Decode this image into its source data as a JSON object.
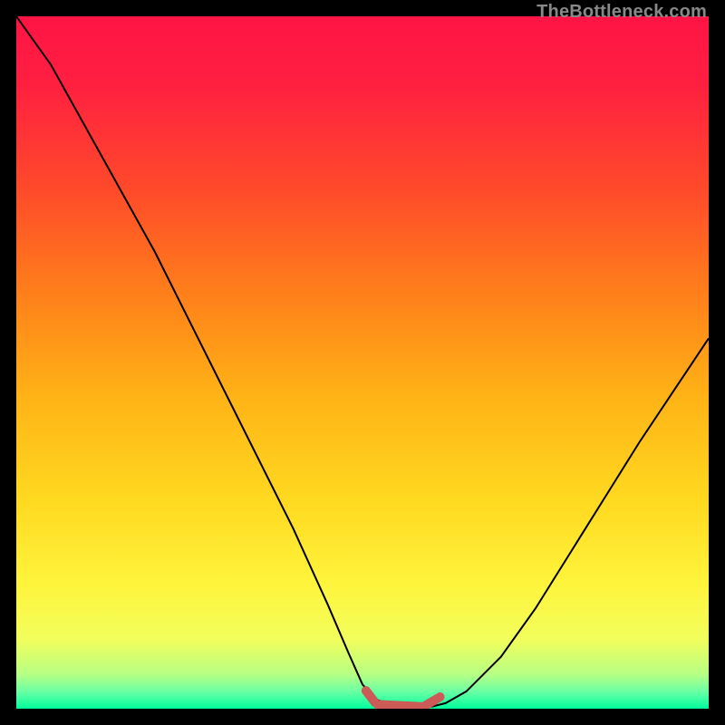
{
  "watermark": "TheBottleneck.com",
  "gradient_stops": [
    {
      "offset": 0.0,
      "color": "#ff1445"
    },
    {
      "offset": 0.1,
      "color": "#ff2040"
    },
    {
      "offset": 0.25,
      "color": "#ff4a2a"
    },
    {
      "offset": 0.4,
      "color": "#ff7f1a"
    },
    {
      "offset": 0.55,
      "color": "#ffb316"
    },
    {
      "offset": 0.7,
      "color": "#ffd920"
    },
    {
      "offset": 0.82,
      "color": "#fff43c"
    },
    {
      "offset": 0.9,
      "color": "#f2fe5c"
    },
    {
      "offset": 0.95,
      "color": "#b7ff83"
    },
    {
      "offset": 0.975,
      "color": "#6cffa4"
    },
    {
      "offset": 1.0,
      "color": "#00ff9e"
    }
  ],
  "chart_data": {
    "type": "line",
    "title": "",
    "xlabel": "",
    "ylabel": "",
    "xlim": [
      0,
      1
    ],
    "ylim": [
      0,
      100
    ],
    "series": [
      {
        "name": "curve",
        "color": "#000000",
        "stroke_width": 2,
        "x": [
          0.0,
          0.05,
          0.1,
          0.15,
          0.2,
          0.25,
          0.3,
          0.35,
          0.4,
          0.45,
          0.48,
          0.5,
          0.52,
          0.55,
          0.58,
          0.6,
          0.62,
          0.65,
          0.7,
          0.75,
          0.8,
          0.85,
          0.9,
          0.95,
          1.0
        ],
        "y": [
          100.0,
          93.0,
          84.0,
          75.0,
          66.0,
          56.0,
          46.0,
          36.0,
          26.0,
          15.0,
          8.0,
          3.5,
          1.3,
          0.4,
          0.3,
          0.3,
          0.8,
          2.5,
          7.5,
          14.5,
          22.5,
          30.5,
          38.5,
          46.0,
          53.5
        ]
      },
      {
        "name": "valley-marker",
        "color": "#cc5a57",
        "stroke_width": 10,
        "linecap": "round",
        "segments": [
          {
            "x": [
              0.505,
              0.518
            ],
            "y": [
              2.6,
              0.9
            ]
          },
          {
            "x": [
              0.522,
              0.585
            ],
            "y": [
              0.6,
              0.3
            ]
          },
          {
            "x": [
              0.59,
              0.612
            ],
            "y": [
              0.4,
              1.7
            ]
          }
        ]
      }
    ],
    "valley_min_x": 0.57
  }
}
